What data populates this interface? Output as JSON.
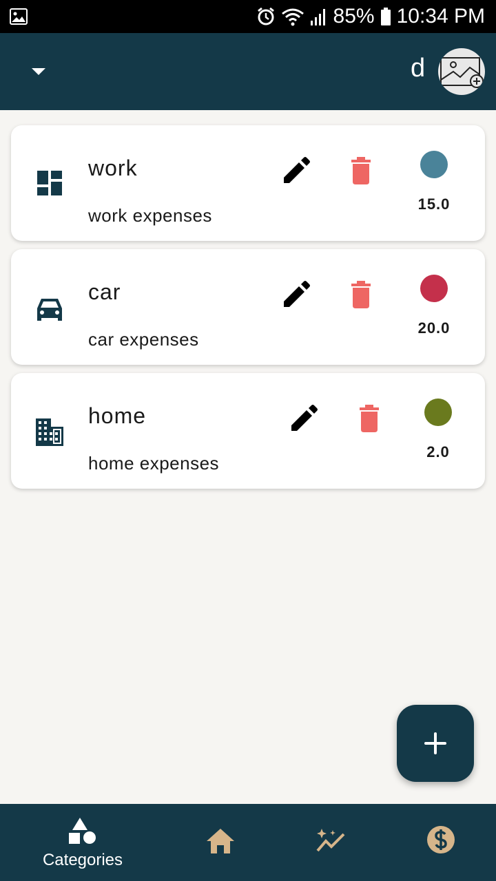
{
  "status_bar": {
    "battery": "85%",
    "time": "10:34 PM"
  },
  "header": {
    "user_initial": "d",
    "dropdown_icon": "caret-down-icon",
    "avatar_icon": "add-photo-icon"
  },
  "categories": [
    {
      "title": "work",
      "description": "work expenses",
      "amount": "15.0",
      "color": "#4a8399",
      "icon": "dashboard-icon"
    },
    {
      "title": "car",
      "description": "car expenses",
      "amount": "20.0",
      "color": "#c4304b",
      "icon": "car-icon"
    },
    {
      "title": "home",
      "description": "home expenses",
      "amount": "2.0",
      "color": "#6a7a1e",
      "icon": "building-icon"
    }
  ],
  "fab": {
    "icon": "plus-icon"
  },
  "bottom_nav": {
    "items": [
      {
        "label": "Categories",
        "icon": "shapes-icon",
        "active": true
      },
      {
        "label": "",
        "icon": "home-icon",
        "active": false
      },
      {
        "label": "",
        "icon": "sparkle-chart-icon",
        "active": false
      },
      {
        "label": "",
        "icon": "dollar-icon",
        "active": false
      }
    ]
  },
  "colors": {
    "primary": "#143948",
    "delete": "#ee6663",
    "nav_inactive": "#d6b58a",
    "background": "#f6f5f2"
  }
}
